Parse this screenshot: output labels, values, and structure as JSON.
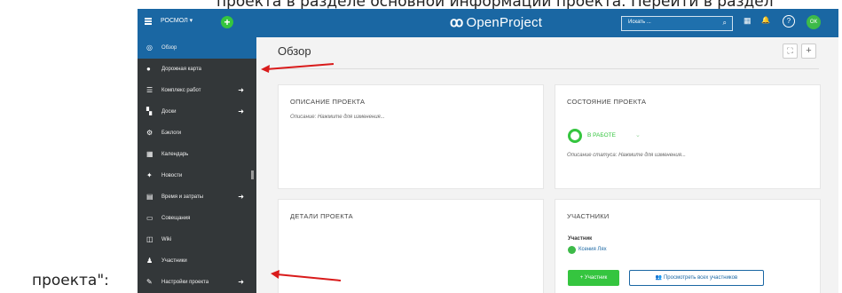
{
  "caption": {
    "top_line": "проекта в разделе основной информации проекта. Перейти в раздел",
    "left_label": "проекта\":"
  },
  "header": {
    "project_select": "РОСМОЛ ▾",
    "plus": "+",
    "logo_mark": "ꝏ",
    "logo_text": "OpenProject",
    "search_placeholder": "Искать ...",
    "search_icon": "⌕",
    "grid_icon": "▦",
    "bell_icon": "🔔",
    "help_label": "?",
    "avatar_initials": "ОК"
  },
  "sidebar": {
    "items": [
      {
        "icon": "◎",
        "label": "Обзор",
        "arrow": ""
      },
      {
        "icon": "●",
        "label": "Дорожная карта",
        "arrow": ""
      },
      {
        "icon": "☰",
        "label": "Комплекс работ",
        "arrow": "➜"
      },
      {
        "icon": "▚",
        "label": "Доски",
        "arrow": "➜"
      },
      {
        "icon": "⚙",
        "label": "Бэклоги",
        "arrow": ""
      },
      {
        "icon": "▦",
        "label": "Календарь",
        "arrow": ""
      },
      {
        "icon": "✦",
        "label": "Новости",
        "arrow": ""
      },
      {
        "icon": "▤",
        "label": "Время и затраты",
        "arrow": "➜"
      },
      {
        "icon": "▭",
        "label": "Совещания",
        "arrow": ""
      },
      {
        "icon": "◫",
        "label": "Wiki",
        "arrow": ""
      },
      {
        "icon": "♟",
        "label": "Участники",
        "arrow": ""
      },
      {
        "icon": "✎",
        "label": "Настройки проекта",
        "arrow": "➜"
      }
    ]
  },
  "main": {
    "title": "Обзор",
    "toolbar": {
      "expand": "⛶",
      "add": "+"
    },
    "widgets": {
      "description": {
        "title": "Описание проекта",
        "text": "Описание: Нажмите для изменения..."
      },
      "status": {
        "title": "Состояние проекта",
        "status_label": "В РАБОТЕ",
        "caret": "⌄",
        "text": "Описание статуса: Нажмите для изменения..."
      },
      "details": {
        "title": "Детали проекта"
      },
      "members": {
        "title": "Участники",
        "role": "Участник",
        "member_name": "Ксения Лях",
        "add_button": "+ Участник",
        "view_all_icon": "👥",
        "view_all_button": "Просмотреть всех участников"
      }
    }
  },
  "colors": {
    "header_blue": "#1a67a3",
    "sidebar_dark": "#333739",
    "accent_green": "#35c53f",
    "annotation_red": "#d91b1b"
  }
}
